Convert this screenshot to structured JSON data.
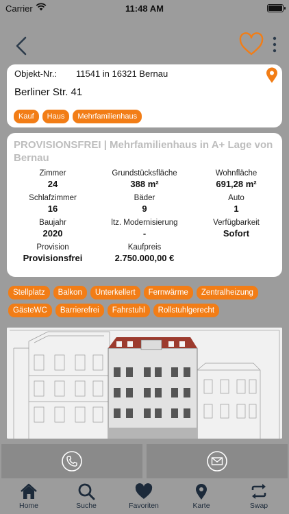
{
  "status_bar": {
    "carrier": "Carrier",
    "time": "11:48 AM"
  },
  "listing": {
    "object_label": "Objekt-Nr.:",
    "object_value": "11541 in 16321 Bernau",
    "address": "Berliner Str. 41",
    "tags": [
      "Kauf",
      "Haus",
      "Mehrfamilienhaus"
    ]
  },
  "details": {
    "title": "PROVISIONSFREI | Mehrfamilienhaus in A+ Lage von Bernau",
    "facts": [
      {
        "label": "Zimmer",
        "value": "24"
      },
      {
        "label": "Grundstücksfläche",
        "value": "388 m²"
      },
      {
        "label": "Wohnfläche",
        "value": "691,28 m²"
      },
      {
        "label": "Schlafzimmer",
        "value": "16"
      },
      {
        "label": "Bäder",
        "value": "9"
      },
      {
        "label": "Auto",
        "value": "1"
      },
      {
        "label": "Baujahr",
        "value": "2020"
      },
      {
        "label": "ltz. Modernisierung",
        "value": "-"
      },
      {
        "label": "Verfügbarkeit",
        "value": "Sofort"
      },
      {
        "label": "Provision",
        "value": "Provisionsfrei"
      },
      {
        "label": "Kaufpreis",
        "value": "2.750.000,00 €"
      }
    ]
  },
  "features": [
    "Stellplatz",
    "Balkon",
    "Unterkellert",
    "Fernwärme",
    "Zentralheizung",
    "GästeWC",
    "Barrierefrei",
    "Fahrstuhl",
    "Rollstuhlgerecht"
  ],
  "tabbar": {
    "items": [
      {
        "label": "Home",
        "icon": "home-icon"
      },
      {
        "label": "Suche",
        "icon": "search-icon"
      },
      {
        "label": "Favoriten",
        "icon": "heart-icon"
      },
      {
        "label": "Karte",
        "icon": "map-pin-icon"
      },
      {
        "label": "Swap",
        "icon": "swap-icon"
      }
    ]
  },
  "colors": {
    "accent": "#f27d16",
    "background": "#9c9c9c",
    "card": "#ffffff",
    "title_gray": "#bdbdbd"
  }
}
